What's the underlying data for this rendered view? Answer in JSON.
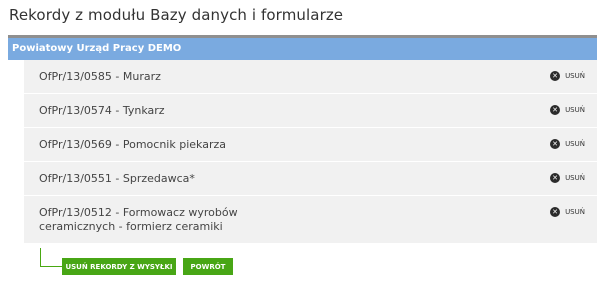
{
  "page_title": "Rekordy z modułu Bazy danych i formularze",
  "group_header": "Powiatowy Urząd Pracy DEMO",
  "delete_label": "usuń",
  "records": [
    {
      "label": "OfPr/13/0585 - Murarz"
    },
    {
      "label": "OfPr/13/0574 - Tynkarz"
    },
    {
      "label": "OfPr/13/0569 - Pomocnik piekarza"
    },
    {
      "label": "OfPr/13/0551 - Sprzedawca*"
    },
    {
      "label": "OfPr/13/0512 - Formowacz wyrobów ceramicznych - formierz ceramiki"
    }
  ],
  "buttons": {
    "remove_from_shipment": "usuń rekordy z wysyłki",
    "back": "powrót"
  },
  "colors": {
    "header_bg": "#7aaae0",
    "row_bg": "#f1f1f1",
    "button_green": "#48a615"
  }
}
